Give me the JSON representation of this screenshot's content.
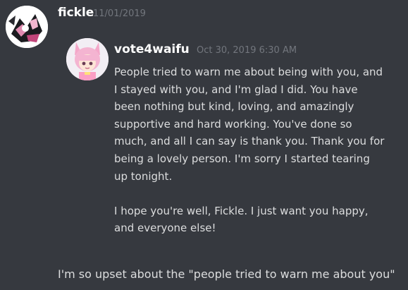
{
  "outer_message": {
    "username": "fickle",
    "timestamp": "11/01/2019",
    "text": "I'm so upset about the \"people tried to warn me about you\"",
    "avatar": "fickle-avatar-icon"
  },
  "quoted_message": {
    "username": "vote4waifu",
    "timestamp": "Oct 30, 2019 6:30 AM",
    "avatar": "vote4waifu-avatar-icon",
    "lines": [
      "People tried to warn me about being with you, and",
      "I stayed with you, and I'm glad I did.  You have",
      "been nothing but kind, loving, and amazingly",
      "supportive and hard working. You've done so",
      "much, and all I can say is thank you. Thank you for",
      "being a lovely person. I'm sorry I started tearing",
      "up tonight.",
      "",
      "I hope you're well, Fickle. I just want you happy,",
      "and everyone else!"
    ]
  },
  "colors": {
    "background": "#36393f",
    "username": "#ffffff",
    "timestamp": "#72767d",
    "text": "#dcddde"
  }
}
